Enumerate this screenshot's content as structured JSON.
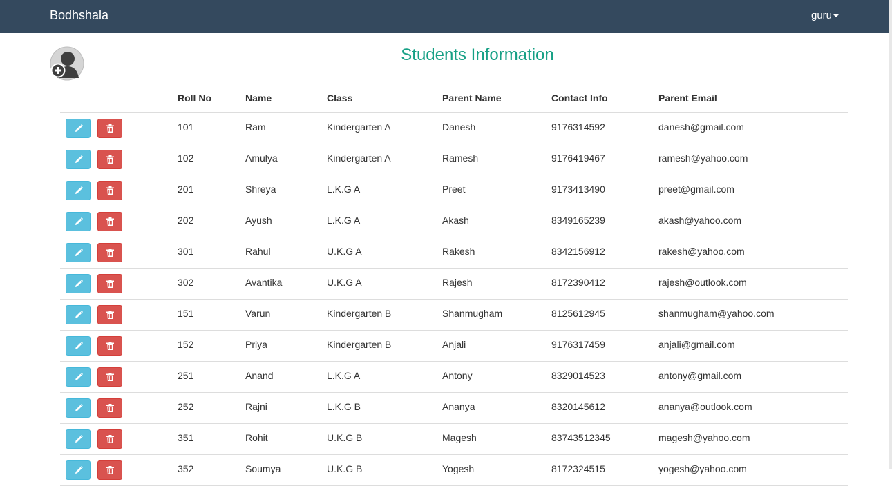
{
  "app": {
    "brand": "Bodhshala",
    "user": "guru"
  },
  "page": {
    "title": "Students Information"
  },
  "icons": {
    "add_user": "add-user-icon",
    "edit": "pencil-icon",
    "delete": "trash-icon",
    "user_menu": "caret-down-icon"
  },
  "colors": {
    "navbar": "#34495e",
    "title": "#16a085",
    "edit_button": "#5bc0de",
    "delete_button": "#d9534f"
  },
  "table": {
    "headers": [
      "Roll No",
      "Name",
      "Class",
      "Parent Name",
      "Contact Info",
      "Parent Email"
    ],
    "rows": [
      [
        "101",
        "Ram",
        "Kindergarten A",
        "Danesh",
        "9176314592",
        "danesh@gmail.com"
      ],
      [
        "102",
        "Amulya",
        "Kindergarten A",
        "Ramesh",
        "9176419467",
        "ramesh@yahoo.com"
      ],
      [
        "201",
        "Shreya",
        "L.K.G A",
        "Preet",
        "9173413490",
        "preet@gmail.com"
      ],
      [
        "202",
        "Ayush",
        "L.K.G A",
        "Akash",
        "8349165239",
        "akash@yahoo.com"
      ],
      [
        "301",
        "Rahul",
        "U.K.G A",
        "Rakesh",
        "8342156912",
        "rakesh@yahoo.com"
      ],
      [
        "302",
        "Avantika",
        "U.K.G A",
        "Rajesh",
        "8172390412",
        "rajesh@outlook.com"
      ],
      [
        "151",
        "Varun",
        "Kindergarten B",
        "Shanmugham",
        "8125612945",
        "shanmugham@yahoo.com"
      ],
      [
        "152",
        "Priya",
        "Kindergarten B",
        "Anjali",
        "9176317459",
        "anjali@gmail.com"
      ],
      [
        "251",
        "Anand",
        "L.K.G A",
        "Antony",
        "8329014523",
        "antony@gmail.com"
      ],
      [
        "252",
        "Rajni",
        "L.K.G B",
        "Ananya",
        "8320145612",
        "ananya@outlook.com"
      ],
      [
        "351",
        "Rohit",
        "U.K.G B",
        "Magesh",
        "83743512345",
        "magesh@yahoo.com"
      ],
      [
        "352",
        "Soumya",
        "U.K.G B",
        "Yogesh",
        "8172324515",
        "yogesh@yahoo.com"
      ]
    ]
  }
}
